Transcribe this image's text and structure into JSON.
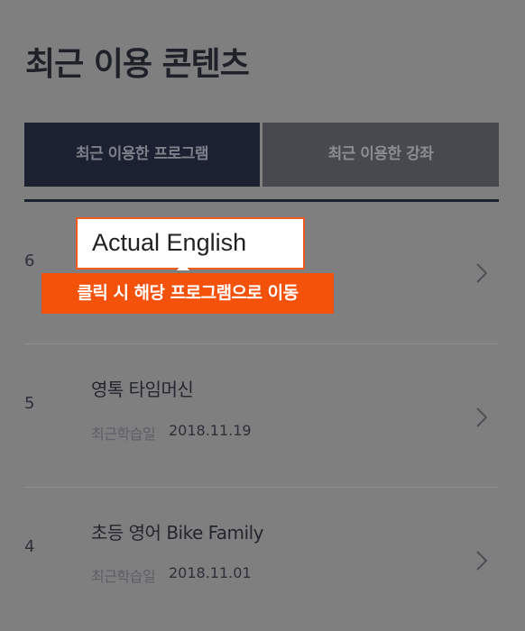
{
  "page": {
    "title": "최근 이용 콘텐츠"
  },
  "tabs": [
    {
      "label": "최근 이용한 프로그램",
      "active": true
    },
    {
      "label": "최근 이용한 강좌",
      "active": false
    }
  ],
  "items": [
    {
      "rank": "6",
      "title": "Actual English",
      "date_label": "",
      "date": ""
    },
    {
      "rank": "5",
      "title": "영톡 타임머신",
      "date_label": "최근학습일",
      "date": "2018.11.19"
    },
    {
      "rank": "4",
      "title": "초등 영어 Bike Family",
      "date_label": "최근학습일",
      "date": "2018.11.01"
    }
  ],
  "callout": {
    "text": "Actual English"
  },
  "tooltip": {
    "text": "클릭 시 해당 프로그램으로 이동"
  },
  "colors": {
    "accent": "#f4510b",
    "tab_active": "#1b2130",
    "overlay": "#7f7f80"
  },
  "icons": {
    "chevron": "chevron-right-icon"
  }
}
